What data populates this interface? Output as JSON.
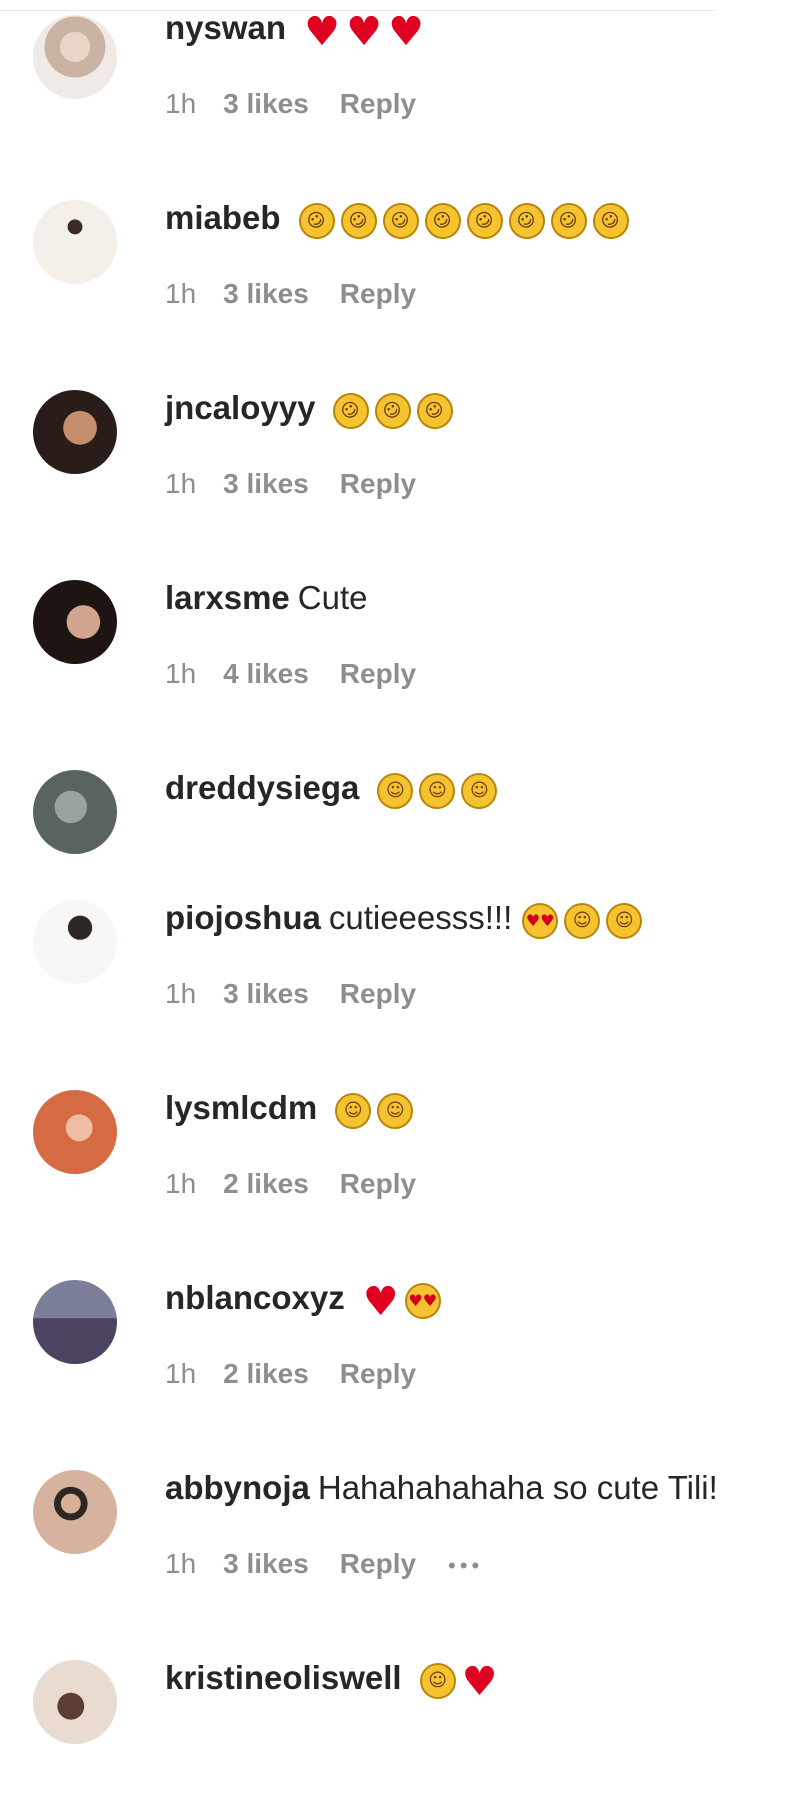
{
  "comments": [
    {
      "username": "nyswan",
      "text": "",
      "emojis": [
        "heart",
        "heart",
        "heart"
      ],
      "time": "1h",
      "likes": "3 likes",
      "reply": "Reply",
      "has_more": false
    },
    {
      "username": "miabeb",
      "text": "",
      "emojis": [
        "rofl",
        "rofl",
        "rofl",
        "rofl",
        "rofl",
        "rofl",
        "rofl",
        "rofl"
      ],
      "time": "1h",
      "likes": "3 likes",
      "reply": "Reply",
      "has_more": false
    },
    {
      "username": "jncaloyyy",
      "text": "",
      "emojis": [
        "rofl",
        "rofl",
        "rofl"
      ],
      "time": "1h",
      "likes": "3 likes",
      "reply": "Reply",
      "has_more": false
    },
    {
      "username": "larxsme",
      "text": "Cute",
      "emojis": [],
      "time": "1h",
      "likes": "4 likes",
      "reply": "Reply",
      "has_more": false
    },
    {
      "username": "dreddysiega",
      "text": "",
      "emojis": [
        "laugh",
        "laugh",
        "laugh"
      ],
      "time": "",
      "likes": "",
      "reply": "",
      "has_more": false
    },
    {
      "username": "piojoshua",
      "text": "cutieeesss!!!",
      "emojis": [
        "hearteyes",
        "laugh",
        "laugh"
      ],
      "time": "1h",
      "likes": "3 likes",
      "reply": "Reply",
      "has_more": false
    },
    {
      "username": "lysmlcdm",
      "text": "",
      "emojis": [
        "laugh",
        "laugh"
      ],
      "time": "1h",
      "likes": "2 likes",
      "reply": "Reply",
      "has_more": false
    },
    {
      "username": "nblancoxyz",
      "text": "",
      "emojis": [
        "heart",
        "hearteyes"
      ],
      "time": "1h",
      "likes": "2 likes",
      "reply": "Reply",
      "has_more": false
    },
    {
      "username": "abbynoja",
      "text": "Hahahahahaha so cute Tili!",
      "emojis": [],
      "time": "1h",
      "likes": "3 likes",
      "reply": "Reply",
      "has_more": true
    },
    {
      "username": "kristineoliswell",
      "text": "",
      "emojis": [
        "laugh",
        "heart"
      ],
      "time": "",
      "likes": "",
      "reply": "",
      "has_more": false
    }
  ],
  "emoji_glyphs": {
    "heart": "♥",
    "laugh": "☺",
    "rofl": "☺",
    "hearteyes": "♥♥"
  },
  "colors": {
    "text": "#262626",
    "meta": "#8e8e8e",
    "heart": "#e0001f",
    "emoji_face": "#f5c230"
  }
}
